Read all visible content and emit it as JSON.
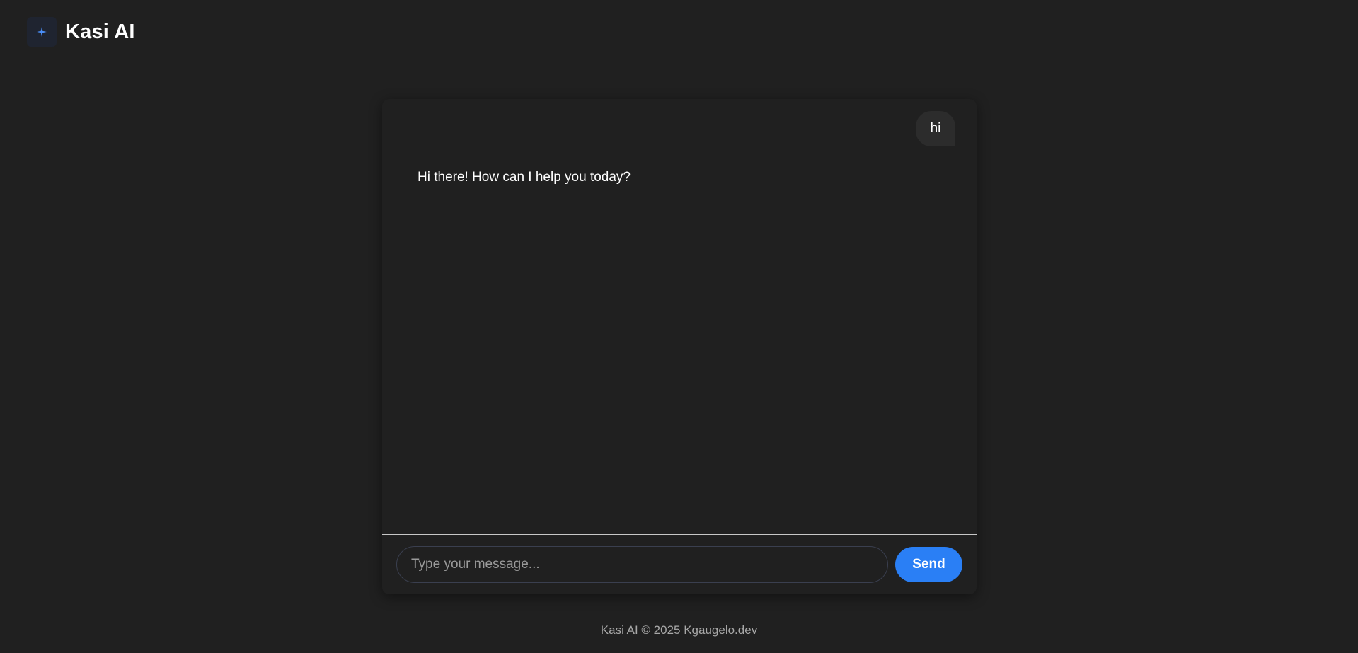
{
  "header": {
    "title": "Kasi AI",
    "logo_icon": "sparkle-icon",
    "logo_color": "#4a8ef7"
  },
  "chat": {
    "messages": [
      {
        "role": "user",
        "text": "hi"
      },
      {
        "role": "assistant",
        "text": "Hi there! How can I help you today?"
      }
    ]
  },
  "composer": {
    "placeholder": "Type your message...",
    "value": "",
    "send_label": "Send",
    "accent": "#2a7ff5"
  },
  "footer": {
    "text": "Kasi AI © 2025 Kgaugelo.dev"
  }
}
